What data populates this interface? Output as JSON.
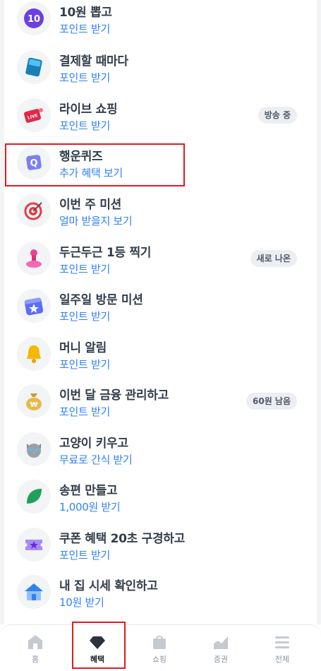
{
  "items": [
    {
      "title": "10원 뽑고",
      "sub": "포인트 받기",
      "icon": "ten-coin-icon"
    },
    {
      "title": "결제할 때마다",
      "sub": "포인트 받기",
      "icon": "card-icon"
    },
    {
      "title": "라이브 쇼핑",
      "sub": "포인트 받기",
      "icon": "live-tv-icon",
      "badge": "방송 중"
    },
    {
      "title": "행운퀴즈",
      "sub": "추가 혜택 보기",
      "icon": "quiz-icon"
    },
    {
      "title": "이번 주 미션",
      "sub": "얼마 받을지 보기",
      "icon": "target-icon"
    },
    {
      "title": "두근두근 1등 찍기",
      "sub": "포인트 받기",
      "icon": "stamp-icon",
      "badge": "새로 나온"
    },
    {
      "title": "일주일 방문 미션",
      "sub": "포인트 받기",
      "icon": "calendar-star-icon"
    },
    {
      "title": "머니 알림",
      "sub": "포인트 받기",
      "icon": "bell-icon"
    },
    {
      "title": "이번 달 금융 관리하고",
      "sub": "포인트 받기",
      "icon": "money-bag-icon",
      "badge": "60원 남음"
    },
    {
      "title": "고양이 키우고",
      "sub": "무료로 간식 받기",
      "icon": "cat-icon"
    },
    {
      "title": "송편 만들고",
      "sub": "1,000원 받기",
      "icon": "leaf-icon"
    },
    {
      "title": "쿠폰 혜택 20초 구경하고",
      "sub": "포인트 받기",
      "icon": "coupon-icon"
    },
    {
      "title": "내 집 시세 확인하고",
      "sub": "10원 받기",
      "icon": "house-icon"
    }
  ],
  "nav": [
    {
      "label": "홈",
      "icon": "home-icon"
    },
    {
      "label": "혜택",
      "icon": "gem-icon",
      "active": true
    },
    {
      "label": "쇼핑",
      "icon": "shopping-bag-icon"
    },
    {
      "label": "증권",
      "icon": "chart-icon"
    },
    {
      "label": "전체",
      "icon": "menu-icon"
    }
  ],
  "colors": {
    "accent": "#3182f6",
    "title": "#333d4b",
    "highlight": "#e11b22"
  }
}
